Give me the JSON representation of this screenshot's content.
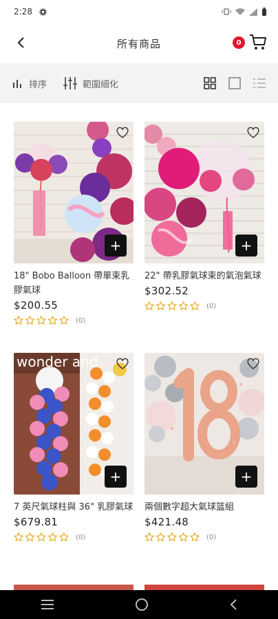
{
  "status": {
    "time": "2:28"
  },
  "header": {
    "title": "所有商品",
    "cart_count": "0"
  },
  "toolbar": {
    "sort_label": "排序",
    "filter_label": "範圍細化"
  },
  "products": [
    {
      "name": "18\" Bobo Balloon 帶單束乳膠氣球",
      "price": "$200.55",
      "reviews": "(0)"
    },
    {
      "name": "22\" 帶乳膠氣球束的氣泡氣球",
      "price": "$302.52",
      "reviews": "(0)"
    },
    {
      "name": "7 英尺氣球柱與 36\" 乳膠氣球",
      "price": "$679.81",
      "reviews": "(0)"
    },
    {
      "name": "兩個數字超大氣球篮組",
      "price": "$421.48",
      "reviews": "(0)"
    }
  ],
  "overlays": {
    "wonderland_text": "wonder and"
  },
  "colors": {
    "accent": "#e0182d",
    "star": "#e6a516",
    "toolbar_bg": "#f3f3f3"
  }
}
